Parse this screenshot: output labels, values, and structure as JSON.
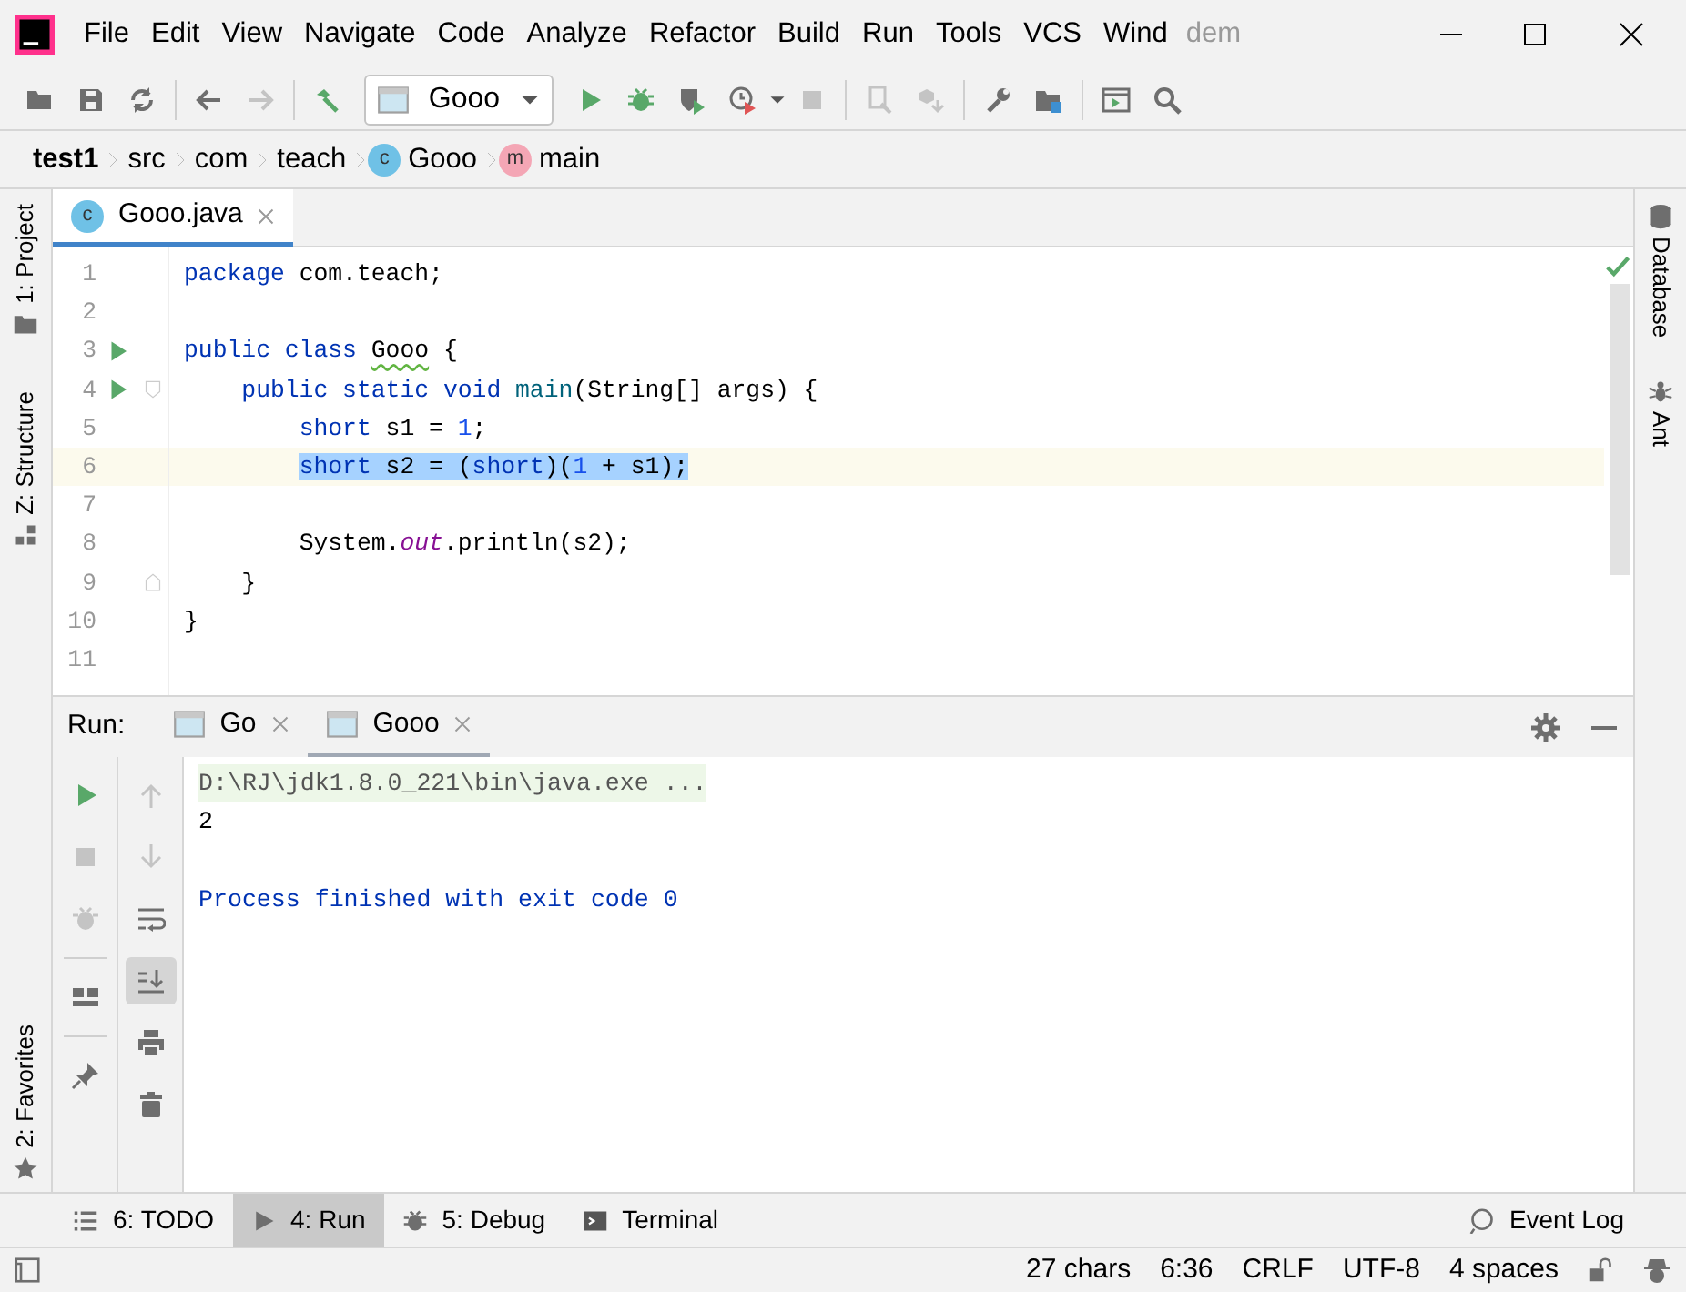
{
  "window": {
    "menu": [
      {
        "label": "File"
      },
      {
        "label": "Edit"
      },
      {
        "label": "View"
      },
      {
        "label": "Navigate"
      },
      {
        "label": "Code"
      },
      {
        "label": "Analyze"
      },
      {
        "label": "Refactor"
      },
      {
        "label": "Build"
      },
      {
        "label": "Run"
      },
      {
        "label": "Tools"
      },
      {
        "label": "VCS"
      },
      {
        "label": "Wind"
      }
    ],
    "title": "dem"
  },
  "toolbar": [
    {
      "kind": "open",
      "disabled": false
    },
    {
      "kind": "save",
      "disabled": false
    },
    {
      "kind": "sync",
      "disabled": false
    },
    {
      "kind": "sep"
    },
    {
      "kind": "back",
      "disabled": false
    },
    {
      "kind": "forward",
      "disabled": true
    },
    {
      "kind": "sep"
    },
    {
      "kind": "build",
      "disabled": false
    },
    {
      "kind": "config",
      "label": "Gooo",
      "disabled": false
    },
    {
      "kind": "run",
      "disabled": false
    },
    {
      "kind": "debug",
      "disabled": false
    },
    {
      "kind": "coverage",
      "disabled": false
    },
    {
      "kind": "profile",
      "disabled": false
    },
    {
      "kind": "stop",
      "disabled": true
    },
    {
      "kind": "sep"
    },
    {
      "kind": "attach",
      "disabled": true
    },
    {
      "kind": "deploy",
      "disabled": true
    },
    {
      "kind": "sep"
    },
    {
      "kind": "settings",
      "disabled": false
    },
    {
      "kind": "structure",
      "disabled": false
    },
    {
      "kind": "sep"
    },
    {
      "kind": "console",
      "disabled": false
    },
    {
      "kind": "search",
      "disabled": false
    }
  ],
  "breadcrumbs": [
    {
      "label": "test1",
      "kind": "project"
    },
    {
      "label": "src",
      "kind": "folder"
    },
    {
      "label": "com",
      "kind": "folder"
    },
    {
      "label": "teach",
      "kind": "folder"
    },
    {
      "label": "Gooo",
      "kind": "class",
      "badge": "c"
    },
    {
      "label": "main",
      "kind": "method",
      "badge": "m"
    }
  ],
  "left_stripe": [
    {
      "label": "1: Project",
      "kind": "project"
    },
    {
      "label": "Z: Structure",
      "kind": "structure"
    },
    {
      "label": "2: Favorites",
      "kind": "favorites"
    }
  ],
  "right_stripe": [
    {
      "label": "Database",
      "kind": "database"
    },
    {
      "label": "Ant",
      "kind": "ant"
    }
  ],
  "editor": {
    "tabs": [
      {
        "label": "Gooo.java",
        "badge": "c",
        "selected": true
      }
    ],
    "lines": [
      {
        "number": "1",
        "run_marker": false,
        "fold_start": false,
        "fold_end": false,
        "current": false,
        "selected": false,
        "tokens": [
          {
            "text": "package",
            "kind": "keyword"
          },
          {
            "text": " com.teach;",
            "kind": "plain"
          }
        ]
      },
      {
        "number": "2",
        "run_marker": false,
        "fold_start": false,
        "fold_end": false,
        "current": false,
        "selected": false
      },
      {
        "number": "3",
        "run_marker": true,
        "fold_start": false,
        "fold_end": false,
        "current": false,
        "selected": false,
        "tokens": [
          {
            "text": "public class",
            "kind": "keyword"
          },
          {
            "text": " Gooo",
            "kind": "warned"
          },
          {
            "text": " {",
            "kind": "plain"
          }
        ]
      },
      {
        "number": "4",
        "run_marker": true,
        "fold_start": true,
        "fold_end": false,
        "current": false,
        "selected": false,
        "tokens": [
          {
            "text": "    public static void",
            "kind": "keyword"
          },
          {
            "text": " main",
            "kind": "method"
          },
          {
            "text": "(String[] args) {",
            "kind": "plain"
          }
        ]
      },
      {
        "number": "5",
        "run_marker": false,
        "fold_start": false,
        "fold_end": false,
        "current": false,
        "selected": false,
        "tokens": [
          {
            "text": "        short",
            "kind": "keyword"
          },
          {
            "text": " s1 = ",
            "kind": "plain"
          },
          {
            "text": "1",
            "kind": "number"
          },
          {
            "text": ";",
            "kind": "plain"
          }
        ]
      },
      {
        "number": "6",
        "run_marker": false,
        "fold_start": false,
        "fold_end": false,
        "current": true,
        "selected": true,
        "tokens": [
          {
            "text": "        short",
            "kind": "keyword"
          },
          {
            "text": " s2 = (",
            "kind": "plain"
          },
          {
            "text": "short",
            "kind": "keyword"
          },
          {
            "text": ")(",
            "kind": "plain"
          },
          {
            "text": "1",
            "kind": "number"
          },
          {
            "text": " + s1);",
            "kind": "plain"
          }
        ]
      },
      {
        "number": "7",
        "run_marker": false,
        "fold_start": false,
        "fold_end": false,
        "current": false,
        "selected": false
      },
      {
        "number": "8",
        "run_marker": false,
        "fold_start": false,
        "fold_end": false,
        "current": false,
        "selected": false,
        "tokens": [
          {
            "text": "        System.",
            "kind": "plain"
          },
          {
            "text": "out",
            "kind": "static"
          },
          {
            "text": ".println(s2);",
            "kind": "plain"
          }
        ]
      },
      {
        "number": "9",
        "run_marker": false,
        "fold_start": false,
        "fold_end": true,
        "current": false,
        "selected": false,
        "tokens": [
          {
            "text": "    }",
            "kind": "plain"
          }
        ]
      },
      {
        "number": "10",
        "run_marker": false,
        "fold_start": false,
        "fold_end": false,
        "current": false,
        "selected": false,
        "tokens": [
          {
            "text": "}",
            "kind": "plain"
          }
        ]
      },
      {
        "number": "11",
        "run_marker": false,
        "fold_start": false,
        "fold_end": false,
        "current": false,
        "selected": false
      }
    ],
    "inspection_ok": true
  },
  "run_panel": {
    "title": "Run:",
    "tabs": [
      {
        "label": "Go",
        "selected": false
      },
      {
        "label": "Gooo",
        "selected": true
      }
    ],
    "actions_left": [
      {
        "kind": "rerun",
        "disabled": false
      },
      {
        "kind": "stop",
        "disabled": true
      },
      {
        "kind": "debug-rerun",
        "disabled": true
      },
      {
        "kind": "sep"
      },
      {
        "kind": "layout",
        "disabled": false
      },
      {
        "kind": "sep"
      },
      {
        "kind": "pin",
        "disabled": false
      }
    ],
    "actions_right": [
      {
        "kind": "up",
        "disabled": true,
        "selected": false
      },
      {
        "kind": "down",
        "disabled": true,
        "selected": false
      },
      {
        "kind": "wrap",
        "disabled": false,
        "selected": false
      },
      {
        "kind": "scroll-end",
        "disabled": false,
        "selected": true
      },
      {
        "kind": "print",
        "disabled": false,
        "selected": false
      },
      {
        "kind": "trash",
        "disabled": false,
        "selected": false
      }
    ],
    "console": [
      {
        "text": "D:\\RJ\\jdk1.8.0_221\\bin\\java.exe ...",
        "kind": "command"
      },
      {
        "text": "2",
        "kind": "output"
      },
      {
        "kind": "blank"
      },
      {
        "text": "Process finished with exit code 0",
        "kind": "system"
      }
    ]
  },
  "tool_windows": [
    {
      "label": "6: TODO",
      "kind": "todo",
      "selected": false
    },
    {
      "label": "4: Run",
      "kind": "run",
      "selected": true
    },
    {
      "label": "5: Debug",
      "kind": "debug",
      "selected": false
    },
    {
      "label": "Terminal",
      "kind": "terminal",
      "selected": false
    }
  ],
  "event_log": {
    "label": "Event Log"
  },
  "status_bar": [
    "27 chars",
    "6:36",
    "CRLF",
    "UTF-8",
    "4 spaces"
  ]
}
